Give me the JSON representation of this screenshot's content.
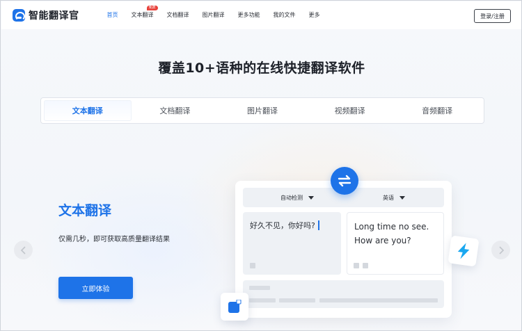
{
  "app": {
    "name": "智能翻译官"
  },
  "nav": {
    "items": [
      {
        "label": "首页",
        "active": true
      },
      {
        "label": "文本翻译",
        "badge": "免费"
      },
      {
        "label": "文档翻译"
      },
      {
        "label": "图片翻译"
      },
      {
        "label": "更多功能"
      },
      {
        "label": "我的文件"
      },
      {
        "label": "更多"
      }
    ],
    "login_label": "登录/注册"
  },
  "hero": {
    "title": "覆盖10+语种的在线快捷翻译软件"
  },
  "tabs": [
    {
      "label": "文本翻译",
      "active": true
    },
    {
      "label": "文档翻译"
    },
    {
      "label": "图片翻译"
    },
    {
      "label": "视频翻译"
    },
    {
      "label": "音频翻译"
    }
  ],
  "feature": {
    "title": "文本翻译",
    "description": "仅需几秒，即可获取高质量翻译结果",
    "cta_label": "立即体验"
  },
  "translator": {
    "source_lang": "自动检测",
    "target_lang": "英语",
    "source_text": "好久不见，你好吗?",
    "target_text_line1": "Long time no see.",
    "target_text_line2": "How are you?"
  },
  "colors": {
    "accent": "#1e73e8",
    "badge": "#e8413a",
    "bolt": "#19a7f0"
  },
  "icons": {
    "logo": "translator-logo-icon",
    "swap": "swap-arrows-icon",
    "bolt": "lightning-icon",
    "edit": "edit-square-icon",
    "prev": "chevron-left-icon",
    "next": "chevron-right-icon"
  }
}
